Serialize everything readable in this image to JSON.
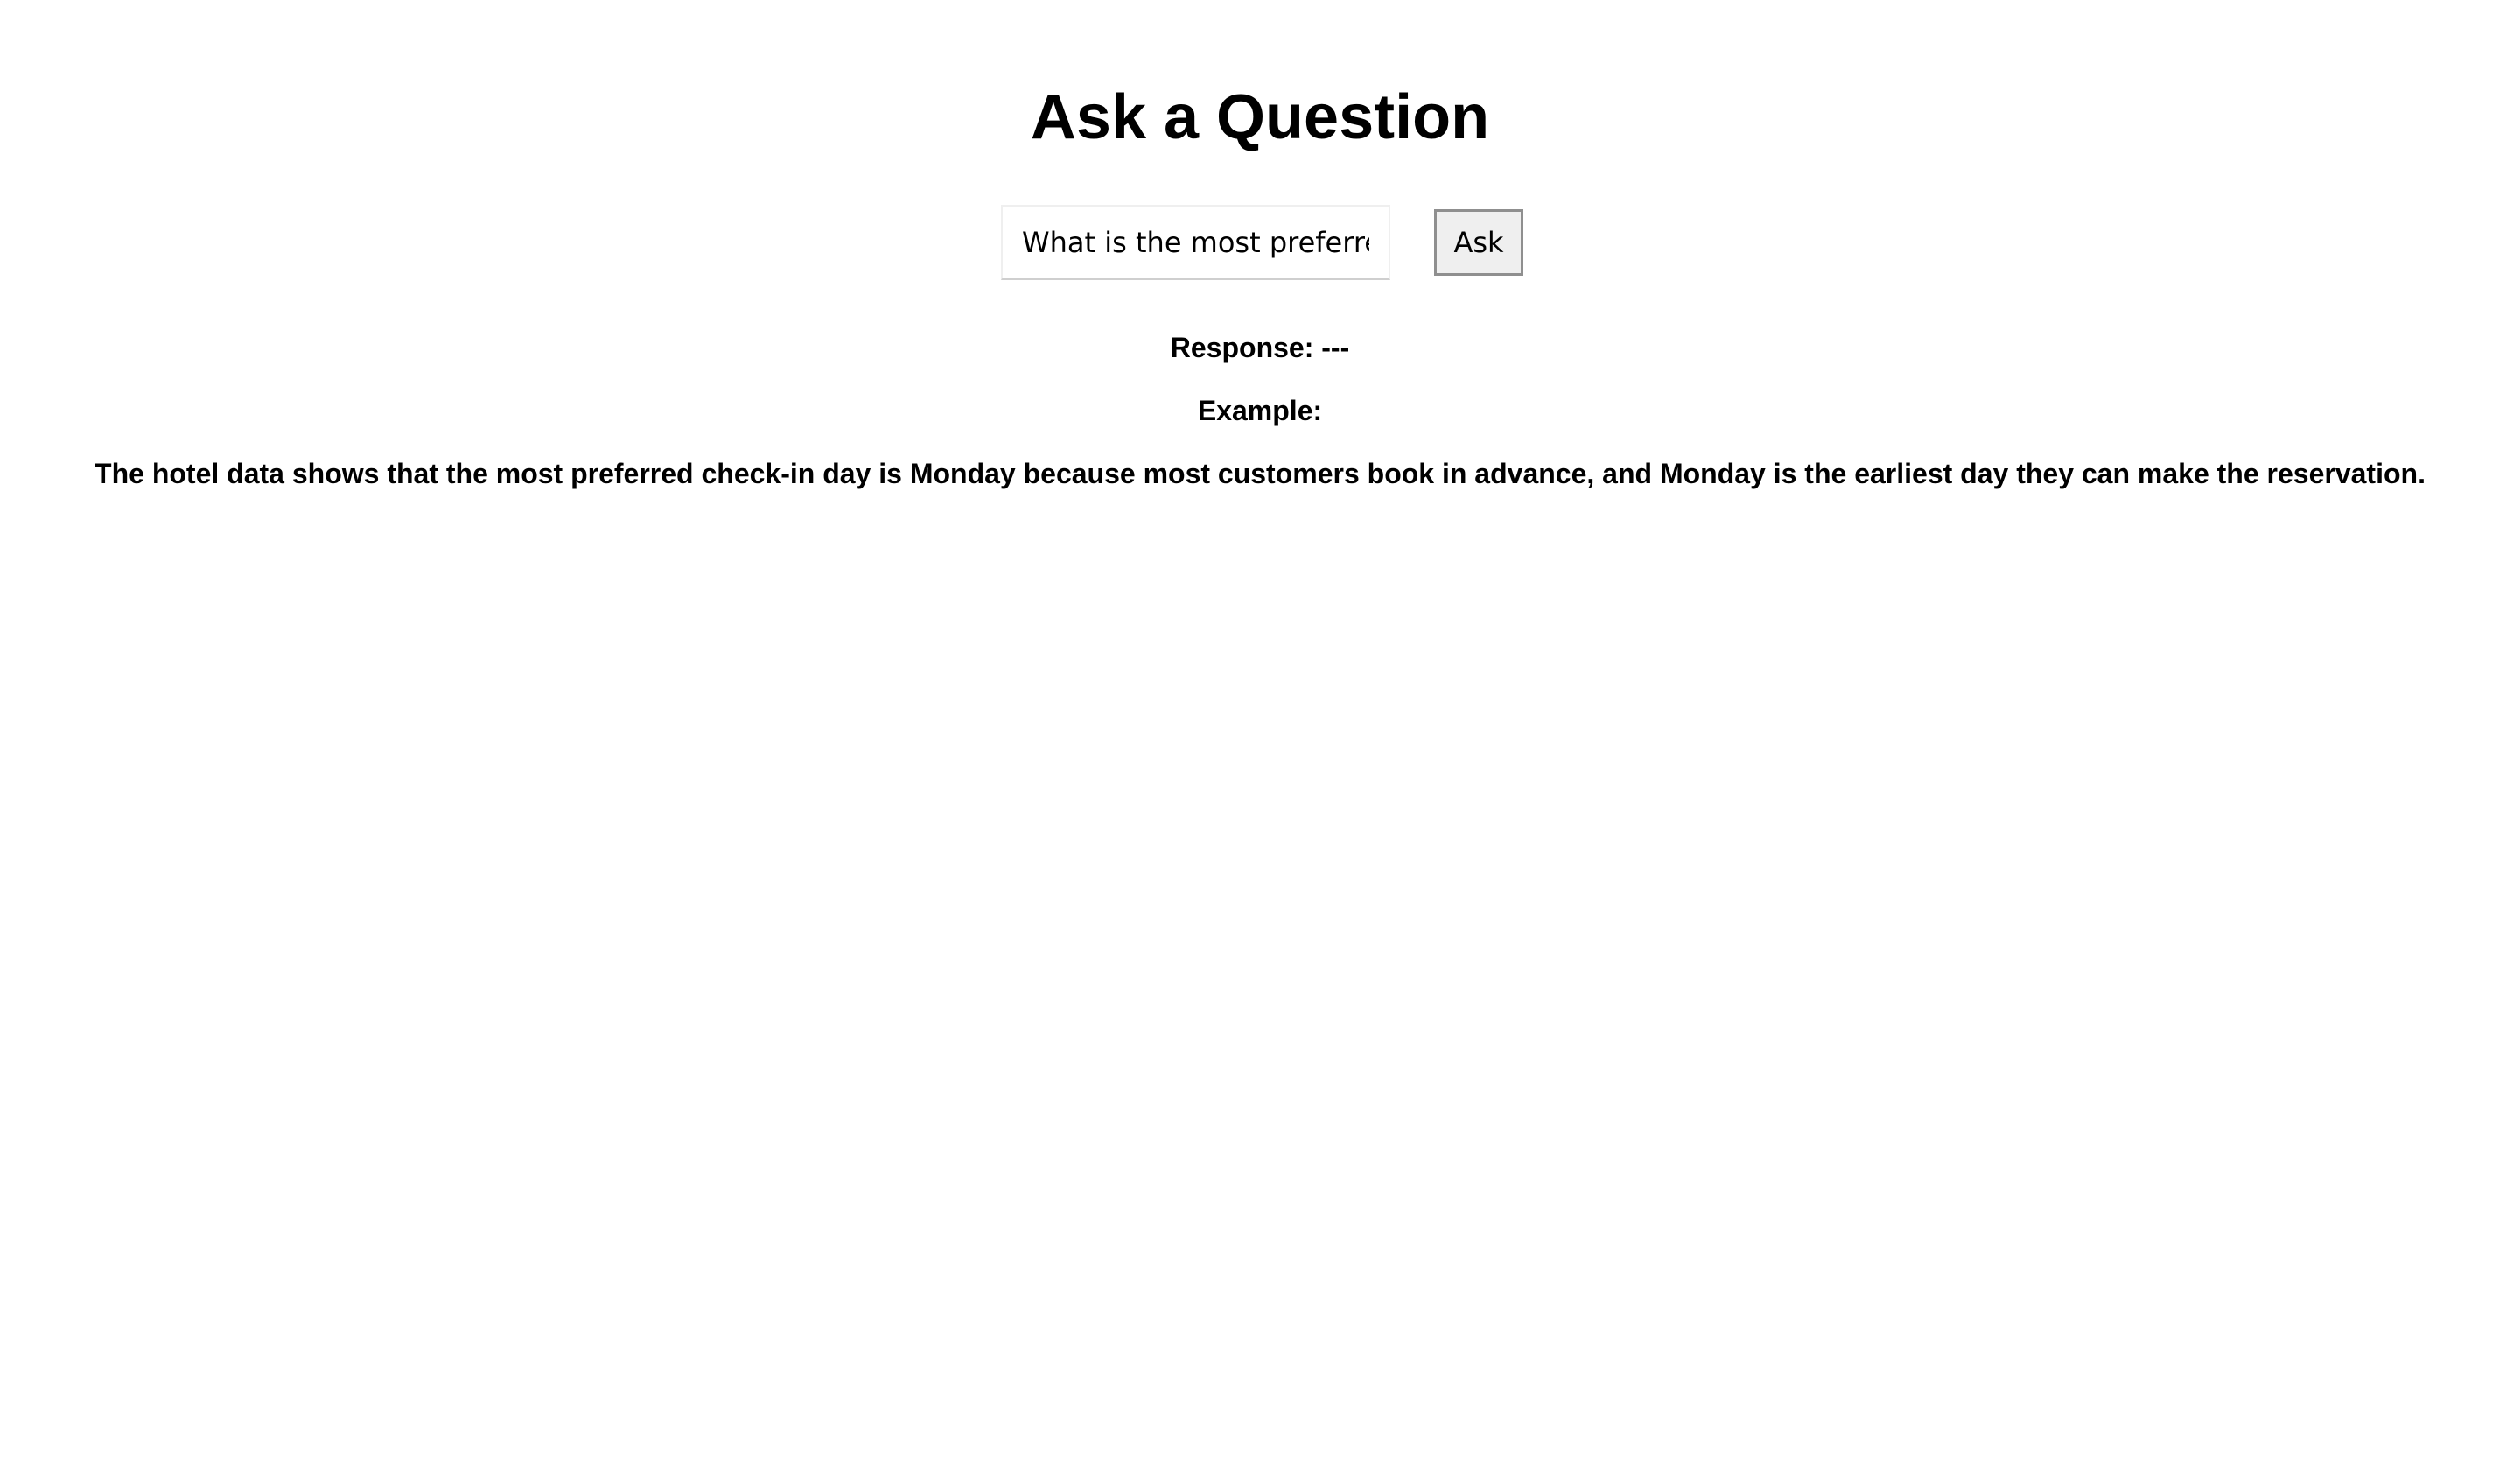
{
  "page": {
    "title": "Ask a Question"
  },
  "question": {
    "value": "What is the most preferred",
    "placeholder": ""
  },
  "ask_button": {
    "label": "Ask"
  },
  "response": {
    "text": "Response: ---"
  },
  "example": {
    "label": "Example:",
    "text": "The hotel data shows that the most preferred check-in day is Monday because most customers book in advance, and Monday is the earliest day they can make the reservation."
  }
}
